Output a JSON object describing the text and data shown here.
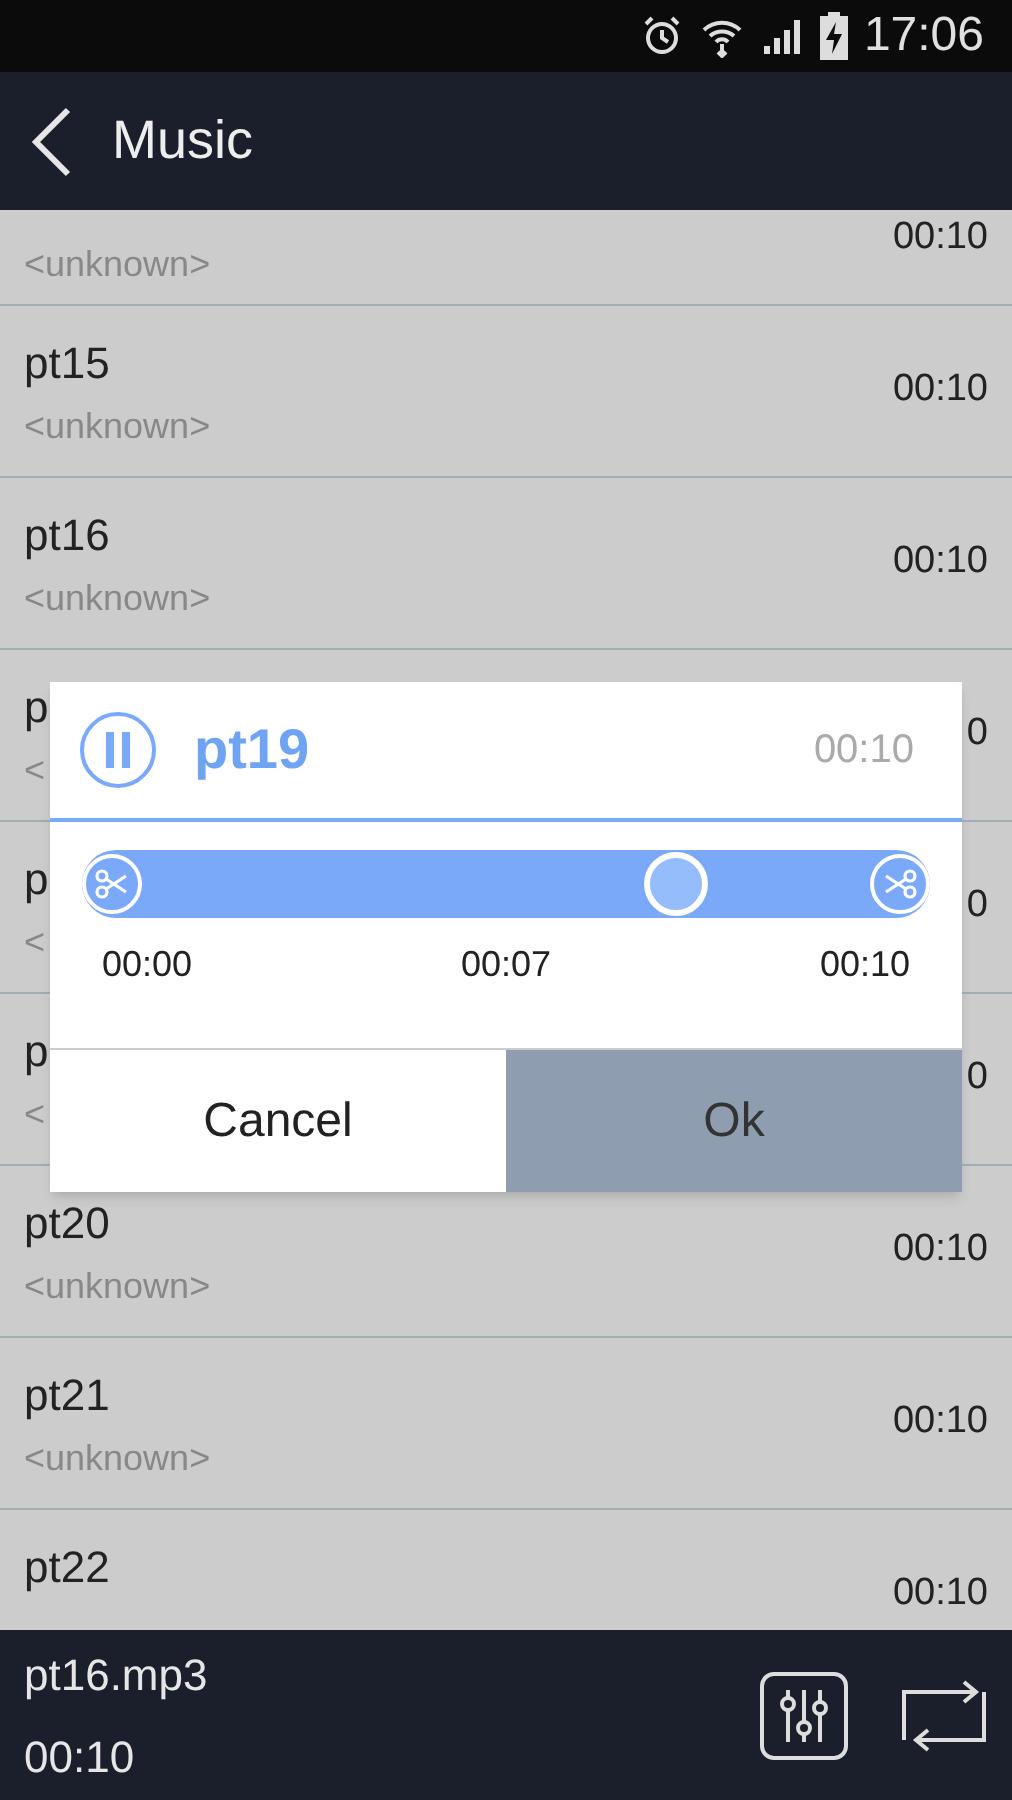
{
  "status_bar": {
    "time": "17:06"
  },
  "header": {
    "title": "Music"
  },
  "tracks": [
    {
      "artist": "<unknown>",
      "duration": "00:10"
    },
    {
      "name": "pt15",
      "artist": "<unknown>",
      "duration": "00:10"
    },
    {
      "name": "pt16",
      "artist": "<unknown>",
      "duration": "00:10"
    },
    {
      "name": "p",
      "artist": "<",
      "duration": "0"
    },
    {
      "name": "p",
      "artist": "<",
      "duration": "0"
    },
    {
      "name": "p",
      "artist": "<",
      "duration": "0"
    },
    {
      "name": "pt20",
      "artist": "<unknown>",
      "duration": "00:10"
    },
    {
      "name": "pt21",
      "artist": "<unknown>",
      "duration": "00:10"
    },
    {
      "name": "pt22",
      "duration": "00:10"
    }
  ],
  "dialog": {
    "title": "pt19",
    "duration": "00:10",
    "playing": true,
    "level": 0.7,
    "marks": [
      "00:00",
      "00:07",
      "00:10"
    ],
    "buttons": [
      {
        "label": "Cancel",
        "kind": "secondary"
      },
      {
        "label": "Ok",
        "kind": "primary"
      }
    ]
  },
  "now_playing": {
    "file": "pt16.mp3",
    "time": "00:10"
  }
}
